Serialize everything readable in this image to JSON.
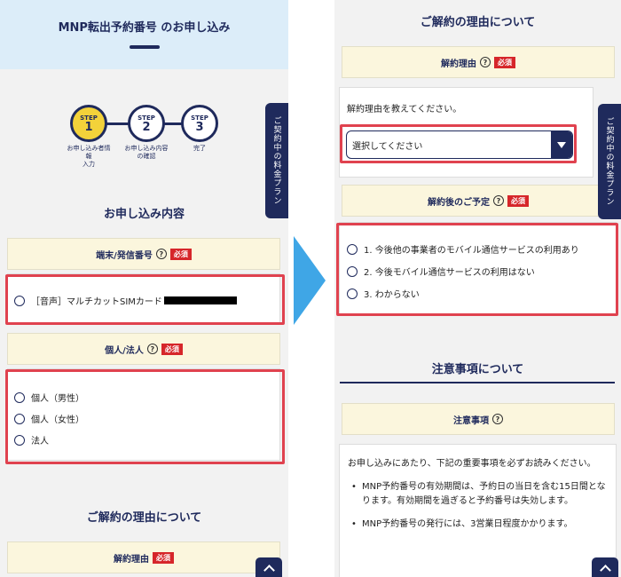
{
  "left": {
    "header_title": "MNP転出予約番号 のお申し込み",
    "steps": [
      {
        "word": "STEP",
        "num": "1",
        "label": "お申し込み者情\n報\n入力",
        "active": true
      },
      {
        "word": "STEP",
        "num": "2",
        "label": "お申し込み内容\nの確認",
        "active": false
      },
      {
        "word": "STEP",
        "num": "3",
        "label": "完了",
        "active": false
      }
    ],
    "section_title": "お申し込み内容",
    "device_field": {
      "label": "端末/発信番号",
      "help": "?",
      "required": "必須",
      "option": "［音声］マルチカットSIMカード"
    },
    "person_field": {
      "label": "個人/法人",
      "help": "?",
      "required": "必須",
      "options": [
        "個人（男性）",
        "個人（女性）",
        "法人"
      ]
    },
    "reason_section_title": "ご解約の理由について",
    "reason_field": {
      "label": "解約理由",
      "required": "必須"
    },
    "side_tab": "ご契約中の料金プラン"
  },
  "right": {
    "section_title": "ご解約の理由について",
    "reason_field": {
      "label": "解約理由",
      "help": "?",
      "required": "必須",
      "prompt": "解約理由を教えてください。",
      "select_value": "選択してください"
    },
    "plan_field": {
      "label": "解約後のご予定",
      "help": "?",
      "required": "必須",
      "options": [
        "1. 今後他の事業者のモバイル通信サービスの利用あり",
        "2. 今後モバイル通信サービスの利用はない",
        "3. わからない"
      ]
    },
    "notice_section_title": "注意事項について",
    "notice_field": {
      "label": "注意事項",
      "help": "?"
    },
    "notice_intro": "お申し込みにあたり、下記の重要事項を必ずお読みください。",
    "notice_items": [
      "MNP予約番号の有効期間は、予約日の当日を含む15日間となります。有効期間を過ぎると予約番号は失効します。",
      "MNP予約番号の発行には、3営業日程度かかります。"
    ],
    "side_tab": "ご契約中の料金プラン"
  },
  "colors": {
    "navy": "#1f2a5c",
    "highlight": "#e0424f",
    "accent_blue": "#3fa6e6",
    "required_red": "#d6262a",
    "step_active": "#f3d23a"
  }
}
